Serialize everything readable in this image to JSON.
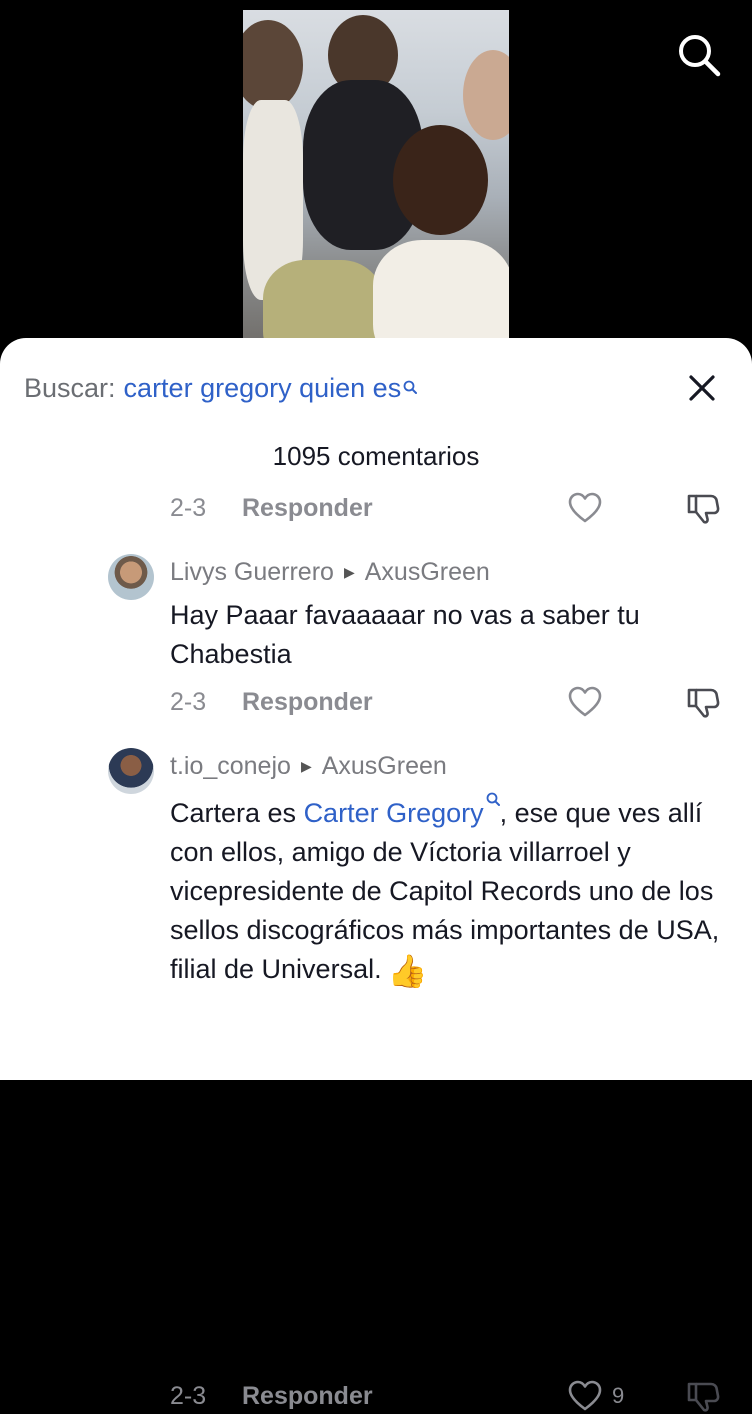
{
  "search": {
    "label": "Buscar:",
    "query": "carter gregory quien es"
  },
  "comments_count": "1095 comentarios",
  "first_meta": {
    "date": "2-3",
    "reply": "Responder"
  },
  "comments": [
    {
      "user": "Livys Guerrero",
      "reply_to": "AxusGreen",
      "text": "Hay Paaar favaaaaar no vas a saber tu Chabestia",
      "date": "2-3",
      "reply": "Responder"
    },
    {
      "user": "t.io_conejo",
      "reply_to": "AxusGreen",
      "text_before": "Cartera es ",
      "link": "Carter Gregory",
      "text_after": ", ese que ves allí con ellos, amigo de Víctoria villarroel y vicepresidente de Capitol Records uno de los sellos discográficos más importantes de USA, filial de Universal.",
      "emoji": "👍",
      "date": "2-3",
      "reply": "Responder",
      "likes": "9"
    }
  ],
  "colors": {
    "link": "#2f61c8",
    "muted": "#8a8b91",
    "text": "#161823"
  },
  "icons": [
    "search-icon",
    "close-icon",
    "heart-outline-icon",
    "dislike-icon",
    "search-suggest-icon",
    "play-arrow-icon"
  ]
}
